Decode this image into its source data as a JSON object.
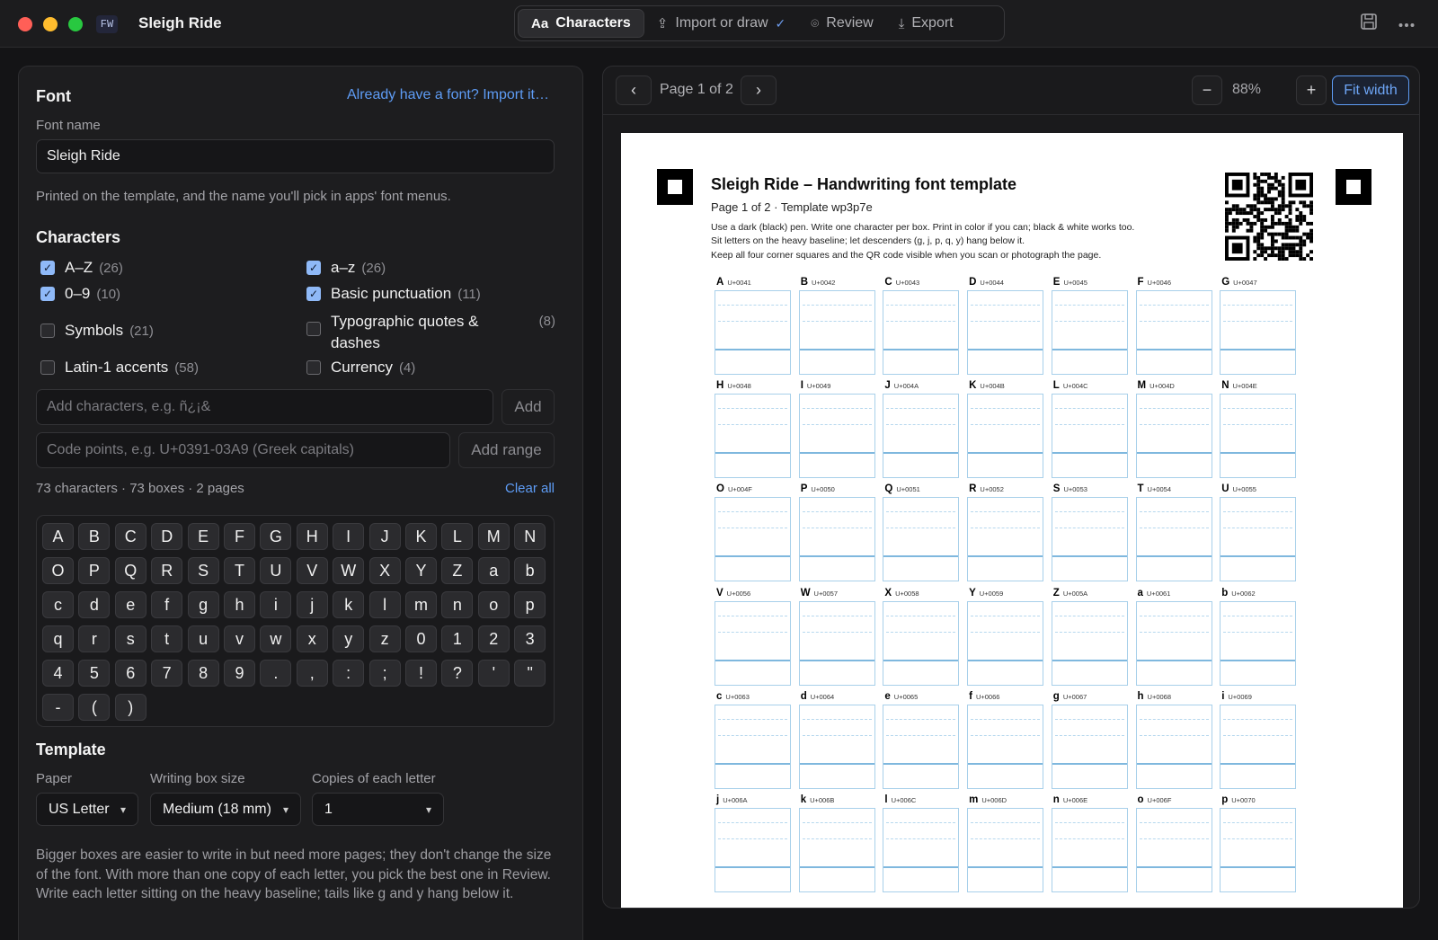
{
  "app": {
    "logo": "FW",
    "title": "Sleigh Ride",
    "tabs": [
      {
        "label": "Characters",
        "icon": "Aa"
      },
      {
        "label": "Import or draw",
        "icon": "upload-icon"
      },
      {
        "label": "Review",
        "icon": "scan-icon"
      },
      {
        "label": "Export",
        "icon": "download-icon"
      }
    ]
  },
  "font": {
    "heading": "Font",
    "import_link": "Already have a font? Import it…",
    "name_label": "Font name",
    "name_value": "Sleigh Ride",
    "name_help": "Printed on the template, and the name you'll pick in apps' font menus."
  },
  "characters": {
    "heading": "Characters",
    "sets": [
      {
        "label": "A–Z",
        "count": "(26)",
        "checked": true
      },
      {
        "label": "a–z",
        "count": "(26)",
        "checked": true
      },
      {
        "label": "0–9",
        "count": "(10)",
        "checked": true
      },
      {
        "label": "Basic punctuation",
        "count": "(11)",
        "checked": true
      },
      {
        "label": "Symbols",
        "count": "(21)",
        "checked": false
      },
      {
        "label": "Typographic quotes & dashes",
        "count": "(8)",
        "checked": false
      },
      {
        "label": "Latin-1 accents",
        "count": "(58)",
        "checked": false
      },
      {
        "label": "Currency",
        "count": "(4)",
        "checked": false
      }
    ],
    "add_placeholder": "Add characters, e.g. ñ¿¡&",
    "add_button": "Add",
    "range_placeholder": "Code points, e.g. U+0391-03A9 (Greek capitals)",
    "range_button": "Add range",
    "summary": "73 characters · 73 boxes · 2 pages",
    "clear_all": "Clear all",
    "chips": [
      "A",
      "B",
      "C",
      "D",
      "E",
      "F",
      "G",
      "H",
      "I",
      "J",
      "K",
      "L",
      "M",
      "N",
      "O",
      "P",
      "Q",
      "R",
      "S",
      "T",
      "U",
      "V",
      "W",
      "X",
      "Y",
      "Z",
      "a",
      "b",
      "c",
      "d",
      "e",
      "f",
      "g",
      "h",
      "i",
      "j",
      "k",
      "l",
      "m",
      "n",
      "o",
      "p",
      "q",
      "r",
      "s",
      "t",
      "u",
      "v",
      "w",
      "x",
      "y",
      "z",
      "0",
      "1",
      "2",
      "3",
      "4",
      "5",
      "6",
      "7",
      "8",
      "9",
      ".",
      ",",
      ":",
      ";",
      "!",
      "?",
      "'",
      "\"",
      "-",
      "(",
      ")"
    ]
  },
  "template": {
    "heading": "Template",
    "paper_label": "Paper",
    "paper_value": "US Letter",
    "box_label": "Writing box size",
    "box_value": "Medium (18 mm)",
    "copies_label": "Copies of each letter",
    "copies_value": "1",
    "help": "Bigger boxes are easier to write in but need more pages; they don't change the size of the font. With more than one copy of each letter, you pick the best one in Review. Write each letter sitting on the heavy baseline; tails like g and y hang below it."
  },
  "preview": {
    "page_label": "Page 1 of 2",
    "zoom": "88%",
    "fit_width": "Fit width",
    "doc_title": "Sleigh Ride – Handwriting font template",
    "doc_sub": "Page 1 of 2  ·  Template wp3p7e",
    "doc_instructions": [
      "Use a dark (black) pen. Write one character per box. Print in color if you can; black & white works too.",
      "Sit letters on the heavy baseline; let descenders (g, j, p, q, y) hang below it.",
      "Keep all four corner squares and the QR code visible when you scan or photograph the page."
    ],
    "cells": [
      {
        "ch": "A",
        "cp": "U+0041"
      },
      {
        "ch": "B",
        "cp": "U+0042"
      },
      {
        "ch": "C",
        "cp": "U+0043"
      },
      {
        "ch": "D",
        "cp": "U+0044"
      },
      {
        "ch": "E",
        "cp": "U+0045"
      },
      {
        "ch": "F",
        "cp": "U+0046"
      },
      {
        "ch": "G",
        "cp": "U+0047"
      },
      {
        "ch": "H",
        "cp": "U+0048"
      },
      {
        "ch": "I",
        "cp": "U+0049"
      },
      {
        "ch": "J",
        "cp": "U+004A"
      },
      {
        "ch": "K",
        "cp": "U+004B"
      },
      {
        "ch": "L",
        "cp": "U+004C"
      },
      {
        "ch": "M",
        "cp": "U+004D"
      },
      {
        "ch": "N",
        "cp": "U+004E"
      },
      {
        "ch": "O",
        "cp": "U+004F"
      },
      {
        "ch": "P",
        "cp": "U+0050"
      },
      {
        "ch": "Q",
        "cp": "U+0051"
      },
      {
        "ch": "R",
        "cp": "U+0052"
      },
      {
        "ch": "S",
        "cp": "U+0053"
      },
      {
        "ch": "T",
        "cp": "U+0054"
      },
      {
        "ch": "U",
        "cp": "U+0055"
      },
      {
        "ch": "V",
        "cp": "U+0056"
      },
      {
        "ch": "W",
        "cp": "U+0057"
      },
      {
        "ch": "X",
        "cp": "U+0058"
      },
      {
        "ch": "Y",
        "cp": "U+0059"
      },
      {
        "ch": "Z",
        "cp": "U+005A"
      },
      {
        "ch": "a",
        "cp": "U+0061"
      },
      {
        "ch": "b",
        "cp": "U+0062"
      },
      {
        "ch": "c",
        "cp": "U+0063"
      },
      {
        "ch": "d",
        "cp": "U+0064"
      },
      {
        "ch": "e",
        "cp": "U+0065"
      },
      {
        "ch": "f",
        "cp": "U+0066"
      },
      {
        "ch": "g",
        "cp": "U+0067"
      },
      {
        "ch": "h",
        "cp": "U+0068"
      },
      {
        "ch": "i",
        "cp": "U+0069"
      },
      {
        "ch": "j",
        "cp": "U+006A"
      },
      {
        "ch": "k",
        "cp": "U+006B"
      },
      {
        "ch": "l",
        "cp": "U+006C"
      },
      {
        "ch": "m",
        "cp": "U+006D"
      },
      {
        "ch": "n",
        "cp": "U+006E"
      },
      {
        "ch": "o",
        "cp": "U+006F"
      },
      {
        "ch": "p",
        "cp": "U+0070"
      }
    ]
  },
  "colors": {
    "accent": "#5e9cf5",
    "checkbox_on": "#8fb9f7",
    "baseline": "#7fb8de"
  }
}
